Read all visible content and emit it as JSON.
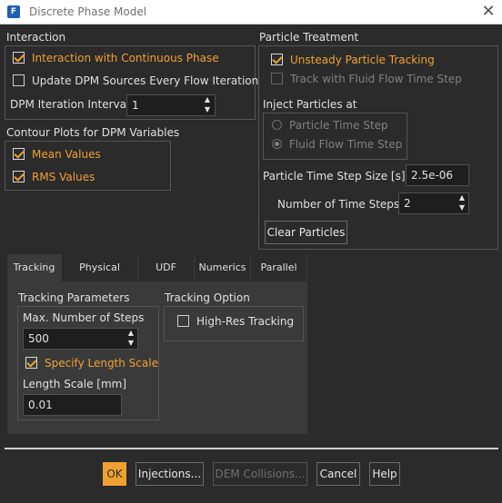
{
  "window": {
    "title": "Discrete Phase Model",
    "app_icon_letter": "F",
    "close_glyph": "✕"
  },
  "interaction": {
    "heading": "Interaction",
    "continuous_phase": {
      "label": "Interaction with Continuous Phase",
      "checked": true
    },
    "update_dpm": {
      "label": "Update DPM Sources Every Flow Iteration",
      "checked": false
    },
    "iteration_interval": {
      "label": "DPM Iteration Interval",
      "value": "1"
    }
  },
  "contour": {
    "heading": "Contour Plots for DPM Variables",
    "mean": {
      "label": "Mean Values",
      "checked": true
    },
    "rms": {
      "label": "RMS Values",
      "checked": true
    }
  },
  "particle_treatment": {
    "heading": "Particle Treatment",
    "unsteady": {
      "label": "Unsteady Particle Tracking",
      "checked": true
    },
    "track_fluid": {
      "label": "Track with Fluid Flow Time Step",
      "checked": false
    },
    "inject_heading": "Inject Particles at",
    "radio_particle": "Particle Time Step",
    "radio_fluid": "Fluid Flow Time Step",
    "selected_radio": "Fluid Flow Time Step",
    "time_step_size": {
      "label": "Particle Time Step Size [s]",
      "value": "2.5e-06"
    },
    "num_steps": {
      "label": "Number of Time Steps",
      "value": "2"
    },
    "clear_button": "Clear Particles"
  },
  "tabs": [
    {
      "label": "Tracking",
      "active": true
    },
    {
      "label": "Physical Models",
      "active": false
    },
    {
      "label": "UDF",
      "active": false
    },
    {
      "label": "Numerics",
      "active": false
    },
    {
      "label": "Parallel",
      "active": false
    }
  ],
  "tracking": {
    "params_heading": "Tracking Parameters",
    "max_steps": {
      "label": "Max. Number of Steps",
      "value": "500"
    },
    "specify_length": {
      "label": "Specify Length Scale",
      "checked": true
    },
    "length_scale": {
      "label": "Length Scale [mm]",
      "value": "0.01"
    },
    "option_heading": "Tracking Option",
    "high_res": {
      "label": "High-Res Tracking",
      "checked": false
    }
  },
  "buttons": {
    "ok": "OK",
    "injections": "Injections...",
    "dem": "DEM Collisions...",
    "cancel": "Cancel",
    "help": "Help"
  },
  "colors": {
    "accent": "#f0a030",
    "background": "#2b2b2b",
    "panel": "#3a3a3a"
  },
  "icons": {
    "spin_up": "▲",
    "spin_down": "▼"
  }
}
